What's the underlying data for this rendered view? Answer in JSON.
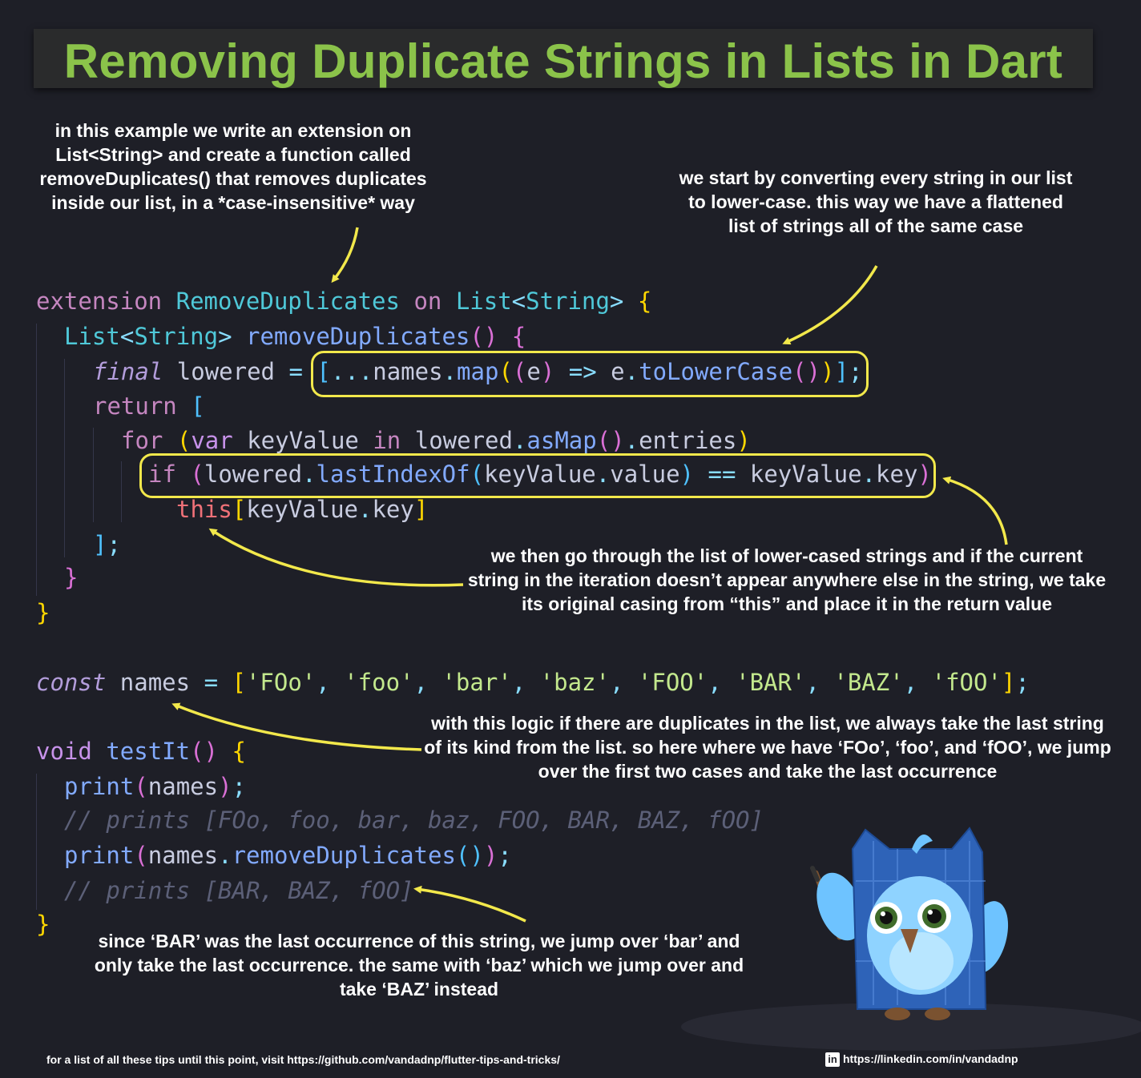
{
  "title": "Removing Duplicate Strings in Lists in Dart",
  "notes": {
    "intro": "in this example we write an extension on List<String> and create a function called removeDuplicates() that removes duplicates inside our list, in a *case-insensitive* way",
    "lowercase": "we start by converting every string in our list to lower-case. this way we have a flattened list of strings all of the same case",
    "iterate": "we then go through the list of lower-cased strings and if the current string in the iteration doesn’t appear anywhere else in the string, we take its original casing from “this” and place it in the return value",
    "logic": "with this logic if there are duplicates in the list, we always take the last string of its kind from the list. so here where we have ‘FOo’, ‘foo’, and ‘fOO’, we jump over the first two cases and take the last occurrence",
    "bar": "since ‘BAR’ was the last occurrence of this string, we jump over ‘bar’ and only take the last occurrence. the same with ‘baz’ which we jump over and take ‘BAZ’ instead"
  },
  "code": {
    "l1": {
      "kw": "extension",
      "name": "RemoveDuplicates",
      "on": "on",
      "type": "List",
      "generic": "String"
    },
    "l2": {
      "type": "List",
      "generic": "String",
      "fn": "removeDuplicates"
    },
    "l3": {
      "kw": "final",
      "var": "lowered",
      "src": "names",
      "map": "map",
      "param": "e",
      "param2": "e",
      "call": "toLowerCase"
    },
    "l4": {
      "kw": "return"
    },
    "l5": {
      "kw": "for",
      "var": "var",
      "name": "keyValue",
      "in": "in",
      "src": "lowered",
      "call": "asMap",
      "prop": "entries"
    },
    "l6": {
      "kw": "if",
      "src": "lowered",
      "call": "lastIndexOf",
      "arg": "keyValue",
      "argprop": "value",
      "cmp": "keyValue",
      "cmpprop": "key"
    },
    "l7": {
      "kw": "this",
      "arg": "keyValue",
      "prop": "key"
    },
    "names": {
      "kw": "const",
      "var": "names",
      "items": [
        "'FOo'",
        "'foo'",
        "'bar'",
        "'baz'",
        "'FOO'",
        "'BAR'",
        "'BAZ'",
        "'fOO'"
      ]
    },
    "test": {
      "kw": "void",
      "fn": "testIt",
      "print": "print",
      "arg": "names",
      "dup": "removeDuplicates"
    },
    "comment1": "// prints [FOo, foo, bar, baz, FOO, BAR, BAZ, fOO]",
    "comment2": "// prints [BAR, BAZ, fOO]"
  },
  "footer": {
    "left": "for a list of all these tips until this point, visit https://github.com/vandadnp/flutter-tips-and-tricks/",
    "linkedin_badge": "in",
    "right": "https://linkedin.com/in/vandadnp"
  },
  "colors": {
    "title": "#8bc34a",
    "highlight": "#f2e84b",
    "arrow": "#f2e84b",
    "background": "#1e1f27"
  },
  "icons": [
    "owl-mascot-illustration",
    "linkedin-icon"
  ]
}
